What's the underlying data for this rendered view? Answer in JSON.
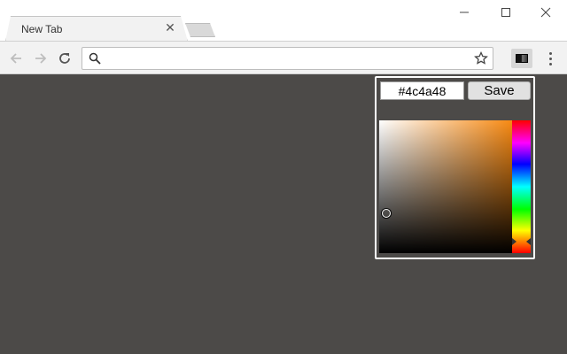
{
  "window": {
    "tab_title": "New Tab",
    "tab_close_icon": "close-icon",
    "controls": [
      "minimize-icon",
      "maximize-icon",
      "close-icon"
    ]
  },
  "toolbar": {
    "address_value": "",
    "address_placeholder": "",
    "icons": [
      "back-arrow-icon",
      "forward-arrow-icon",
      "reload-icon",
      "search-icon",
      "star-icon",
      "extension-icon",
      "menu-icon"
    ]
  },
  "color_picker": {
    "hex_value": "#4c4a48",
    "save_label": "Save",
    "current_color": "#4c4a48",
    "hue_color": "#f88a13"
  },
  "page": {
    "background_color": "#4c4a48"
  }
}
